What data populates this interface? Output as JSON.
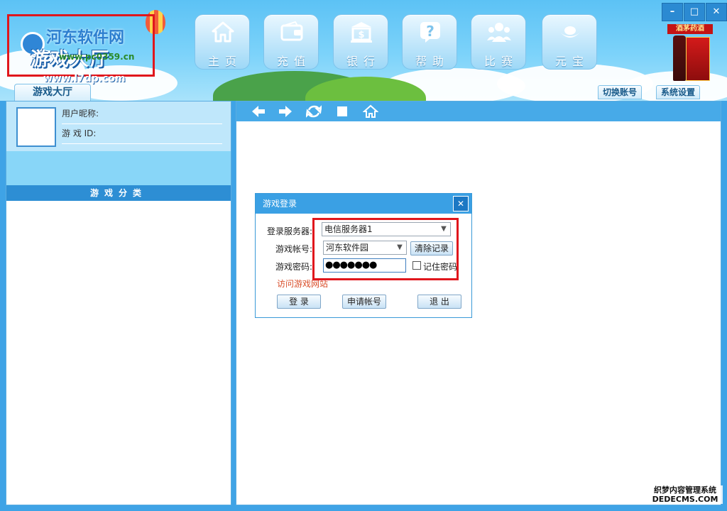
{
  "logo": {
    "site_name": "河东软件网",
    "brand": "游戏大厅",
    "url_overlay": "www.pc0359.cn",
    "url": "www.l7dp.com"
  },
  "nav": [
    {
      "label": "主页",
      "icon": "home-icon"
    },
    {
      "label": "充值",
      "icon": "wallet-icon"
    },
    {
      "label": "银行",
      "icon": "bank-icon"
    },
    {
      "label": "帮助",
      "icon": "help-icon"
    },
    {
      "label": "比赛",
      "icon": "users-icon"
    },
    {
      "label": "元宝",
      "icon": "ingot-icon"
    }
  ],
  "window_buttons": {
    "minimize": "–",
    "maximize": "□",
    "close": "✕"
  },
  "ad": {
    "banner": "酒茅药酒"
  },
  "tabs": {
    "lobby": "游戏大厅",
    "switch_account": "切换账号",
    "settings": "系统设置"
  },
  "user": {
    "nickname_label": "用户昵称:",
    "game_id_label": "游 戏 ID:"
  },
  "category": {
    "title": "游戏分类"
  },
  "toolbar": {
    "back": "back-arrow-icon",
    "forward": "forward-arrow-icon",
    "refresh": "refresh-icon",
    "stop": "stop-icon",
    "home": "home-icon"
  },
  "dialog": {
    "title": "游戏登录",
    "close": "✕",
    "server_label": "登录服务器:",
    "server_value": "电信服务器1",
    "account_label": "游戏帐号:",
    "account_value": "河东软件园",
    "clear_button": "清除记录",
    "password_label": "游戏密码:",
    "password_value": "●●●●●●●",
    "remember_label": "记住密码",
    "visit_link": "访问游戏网站",
    "login_button": "登 录",
    "register_button": "申请帐号",
    "exit_button": "退 出"
  },
  "watermark": {
    "line1": "织梦内容管理系统",
    "line2": "DEDECMS.COM"
  },
  "colors": {
    "accent": "#3aa0e4",
    "highlight_box": "#e0161c",
    "link": "#d94e2a"
  }
}
